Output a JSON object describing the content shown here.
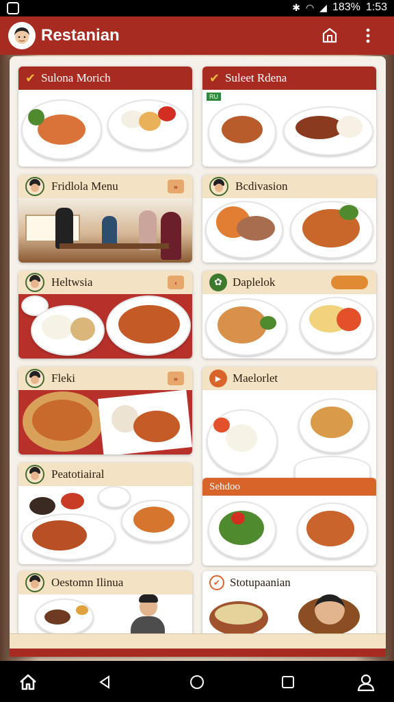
{
  "status": {
    "battery": "183%",
    "time": "1:53"
  },
  "header": {
    "title": "Restanian"
  },
  "cards": [
    {
      "title": "Sulona Morich"
    },
    {
      "title": "Suleet Rdena",
      "tag": "RU"
    },
    {
      "title": "Fridlola Menu",
      "action": "»"
    },
    {
      "title": "Bcdivasion"
    },
    {
      "title": "Heltwsia",
      "action": "‹"
    },
    {
      "title": "Daplelok"
    },
    {
      "title": "Fleki",
      "action": "»"
    },
    {
      "title": "Maelorlet"
    },
    {
      "title": "Peatotiairal"
    },
    {
      "title": "Sehdoo"
    },
    {
      "title": "Oestomn Ilinua"
    },
    {
      "title": "Stotupaanian"
    }
  ],
  "colors": {
    "brand_red": "#a82b22",
    "cream": "#f3e3c4",
    "orange": "#d9642a"
  }
}
